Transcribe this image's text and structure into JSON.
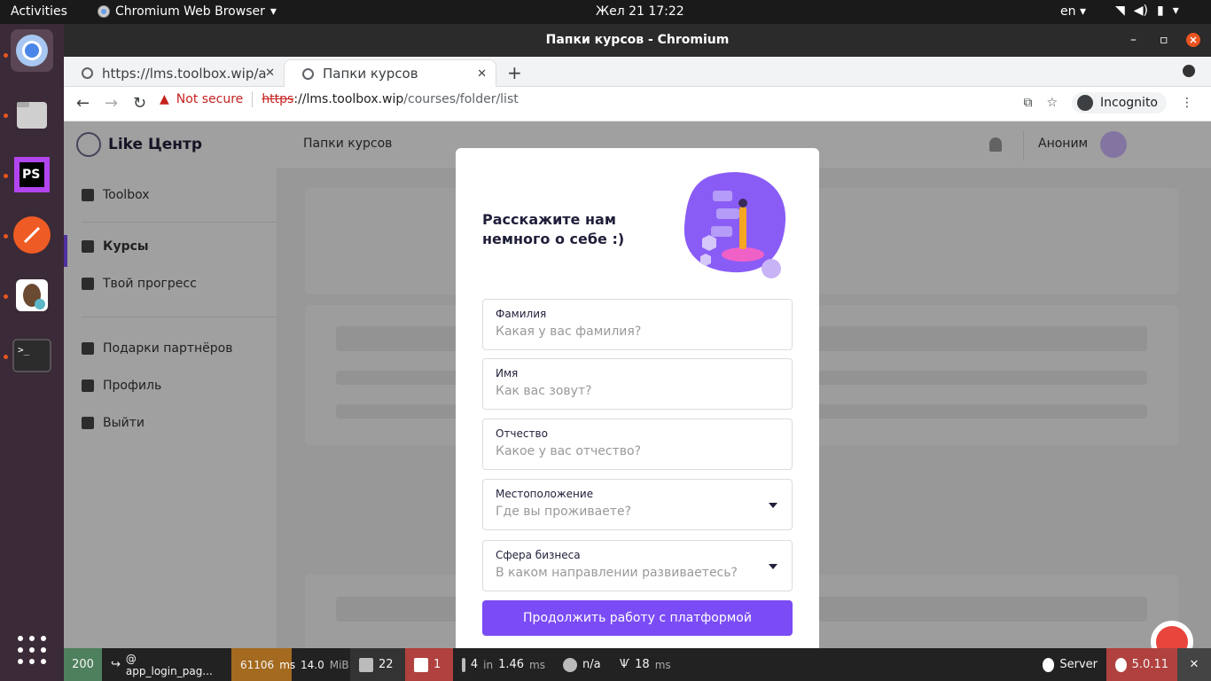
{
  "system": {
    "activities": "Activities",
    "app_menu": "Chromium Web Browser",
    "clock": "Жел 21  17:22",
    "lang": "en"
  },
  "window": {
    "title": "Папки курсов - Chromium"
  },
  "tabs": [
    {
      "label": "https://lms.toolbox.wip/a"
    },
    {
      "label": "Папки курсов"
    }
  ],
  "address": {
    "security": "Not secure",
    "scheme": "https",
    "host": "://lms.toolbox.wip",
    "path": "/courses/folder/list"
  },
  "incognito": "Incognito",
  "app": {
    "brand": "Like Центр",
    "breadcrumb": "Папки курсов",
    "user": "Аноним",
    "menu": [
      {
        "label": "Toolbox"
      },
      {
        "label": "Курсы"
      },
      {
        "label": "Твой прогресс"
      },
      {
        "label": "Подарки партнёров"
      },
      {
        "label": "Профиль"
      },
      {
        "label": "Выйти"
      }
    ]
  },
  "modal": {
    "title": "Расскажите нам немного о себе :)",
    "fields": [
      {
        "label": "Фамилия",
        "placeholder": "Какая у вас фамилия?"
      },
      {
        "label": "Имя",
        "placeholder": "Как вас зовут?"
      },
      {
        "label": "Отчество",
        "placeholder": "Какое у вас отчество?"
      },
      {
        "label": "Местоположение",
        "placeholder": "Где вы проживаете?"
      },
      {
        "label": "Сфера бизнеса",
        "placeholder": "В каком направлении развиваетесь?"
      }
    ],
    "submit": "Продолжить работу с платформой"
  },
  "debugbar": {
    "status": "200",
    "route": "@ app_login_pag...",
    "time": "61106",
    "time_unit": "ms",
    "memory": "14.0",
    "memory_unit": "MiB",
    "requests": "22",
    "errors": "1",
    "queries": "4",
    "queries_in": "in",
    "queries_time": "1.46",
    "queries_unit": "ms",
    "user": "n/a",
    "twig_time": "18",
    "twig_unit": "ms",
    "server": "Server",
    "version": "5.0.11"
  },
  "colors": {
    "accent": "#7b4cf5",
    "status_ok": "#4f805d",
    "status_warn": "#a46a1f",
    "status_error": "#b0413e"
  }
}
